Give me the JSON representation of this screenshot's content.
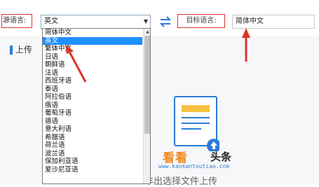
{
  "toolbar": {
    "source_label": "源语言:",
    "source_selected": "英文",
    "target_label": "目标语言:",
    "target_selected": "简体中文"
  },
  "upload": {
    "heading": "上传"
  },
  "dropdown": {
    "options": [
      "简体中文",
      "英文",
      "繁体中文",
      "日语",
      "朝鲜语",
      "法语",
      "西班牙语",
      "泰语",
      "阿拉伯语",
      "俄语",
      "葡萄牙语",
      "德语",
      "意大利语",
      "希腊语",
      "荷兰语",
      "波兰语",
      "保加利亚语",
      "爱沙尼亚语"
    ],
    "selected_index": 1
  },
  "bottom_text": "丰出选择文件上传",
  "watermark": {
    "logo": "看看",
    "logo2": "头条",
    "url": "www.kankantoutiao.com"
  },
  "colors": {
    "accent": "#1e90ff",
    "annotation": "#d9362b"
  }
}
